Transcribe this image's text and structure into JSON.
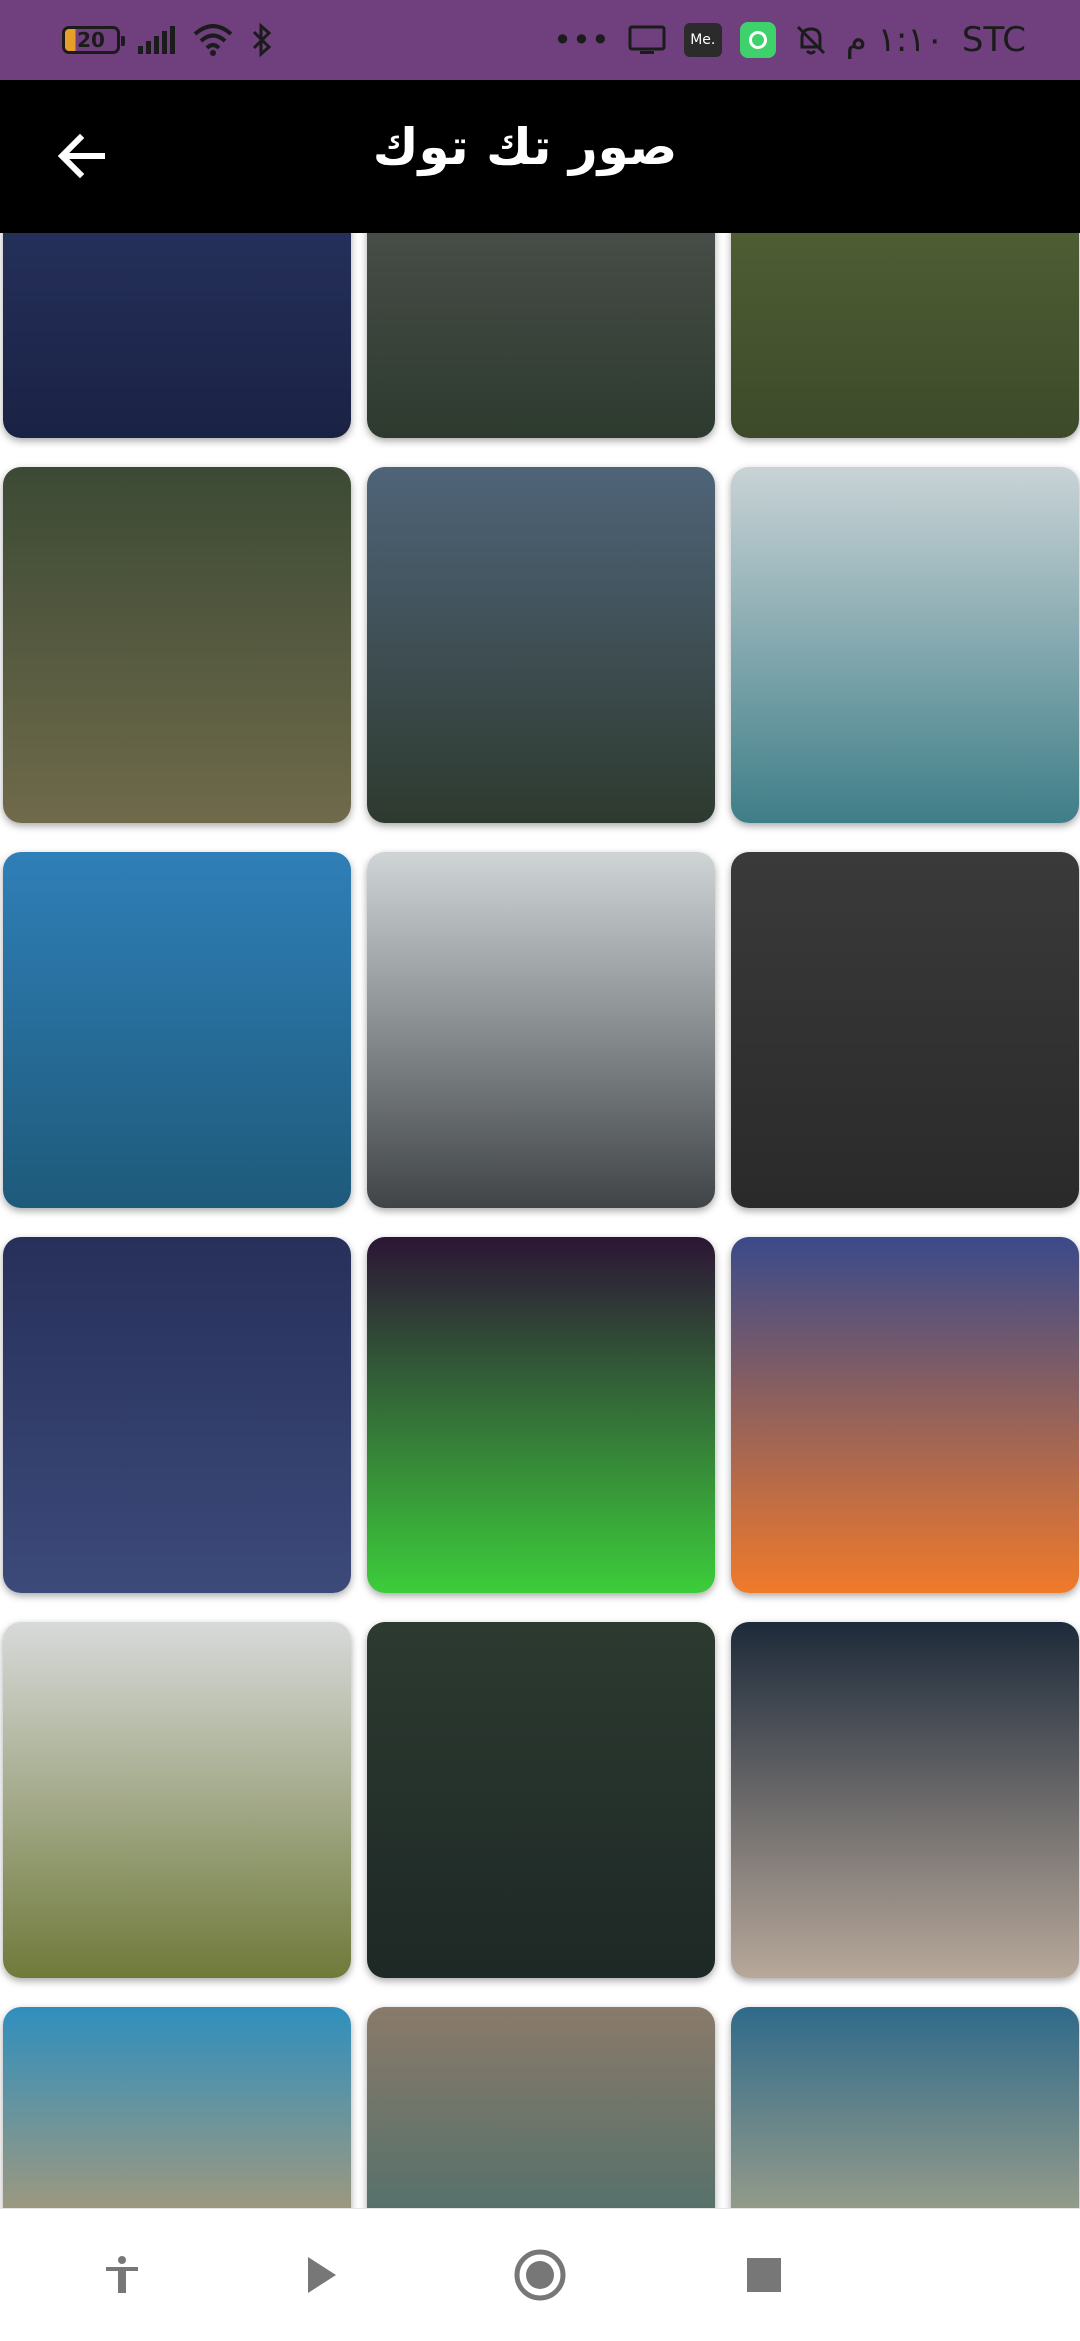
{
  "status_bar": {
    "battery": "20",
    "carrier": "STC",
    "time": "١:١٠ م",
    "overflow": "•••",
    "me_badge": "Me.",
    "icons": [
      "battery-icon",
      "signal-icon",
      "wifi-icon",
      "bluetooth-icon",
      "overflow-icon",
      "screen-icon",
      "me-app-icon",
      "green-app-icon",
      "mute-bell-icon"
    ]
  },
  "app_bar": {
    "title": "صور تك توك",
    "back_icon": "arrow-back-icon"
  },
  "grid": {
    "columns": 3,
    "tiles": [
      {
        "name": "partial-night-sky",
        "colors": [
          "#2c3a6a",
          "#1a2244"
        ]
      },
      {
        "name": "partial-dark-forest",
        "colors": [
          "#5a5a5a",
          "#2d3a2e"
        ]
      },
      {
        "name": "partial-moss",
        "colors": [
          "#5a6b3a",
          "#3d4a2a"
        ]
      },
      {
        "name": "forest-cabin",
        "colors": [
          "#3c4a35",
          "#6f6a4a"
        ]
      },
      {
        "name": "mountain-forest-sunset",
        "colors": [
          "#4f6479",
          "#2e3a2f"
        ]
      },
      {
        "name": "lake-valley",
        "colors": [
          "#c9d3d6",
          "#3f7e88"
        ]
      },
      {
        "name": "island-aerial",
        "colors": [
          "#2f7fb8",
          "#1e5a7a"
        ]
      },
      {
        "name": "empty-road",
        "colors": [
          "#cfd5d6",
          "#404447"
        ]
      },
      {
        "name": "dark-leaves",
        "colors": [
          "#3a3a3a",
          "#2a2a2a"
        ]
      },
      {
        "name": "starry-sea-sailboat",
        "colors": [
          "#27305a",
          "#3c4a7a"
        ]
      },
      {
        "name": "aurora",
        "colors": [
          "#2c1535",
          "#3ccd3a"
        ]
      },
      {
        "name": "sunset-over-water",
        "colors": [
          "#3a4a8a",
          "#f07a2a"
        ]
      },
      {
        "name": "meadow-forest",
        "colors": [
          "#d8dada",
          "#6f7a3a"
        ]
      },
      {
        "name": "forest-road",
        "colors": [
          "#2c3a30",
          "#1e2826"
        ]
      },
      {
        "name": "leaf-on-water",
        "colors": [
          "#1d2a3a",
          "#b8a89a"
        ]
      },
      {
        "name": "beach-sunset",
        "colors": [
          "#2f8fbe",
          "#f0a050"
        ]
      },
      {
        "name": "sea-cliff",
        "colors": [
          "#8a7a6a",
          "#2f6a6a"
        ]
      },
      {
        "name": "tropical-beach",
        "colors": [
          "#2f6a8a",
          "#e0c08a"
        ]
      }
    ]
  },
  "bottom_nav": {
    "buttons": [
      "accessibility-icon",
      "play-icon",
      "record-icon",
      "stop-icon"
    ]
  }
}
